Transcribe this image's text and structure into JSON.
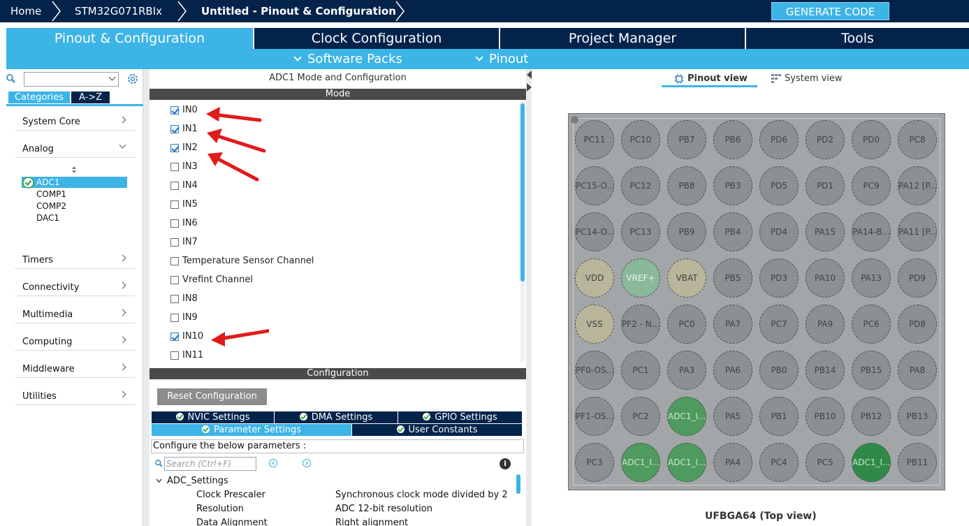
{
  "breadcrumb": {
    "home": "Home",
    "device": "STM32G071RBIx",
    "project": "Untitled - Pinout & Configuration"
  },
  "generate_label": "GENERATE CODE",
  "main_tabs": [
    "Pinout & Configuration",
    "Clock Configuration",
    "Project Manager",
    "Tools"
  ],
  "sub_menu": {
    "software_packs": "Software Packs",
    "pinout": "Pinout"
  },
  "left": {
    "tabs": [
      "Categories",
      "A->Z"
    ],
    "categories": [
      "System Core",
      "Analog",
      "Timers",
      "Connectivity",
      "Multimedia",
      "Computing",
      "Middleware",
      "Utilities"
    ],
    "analog_items": [
      "ADC1",
      "COMP1",
      "COMP2",
      "DAC1"
    ]
  },
  "mode": {
    "title": "ADC1 Mode and Configuration",
    "header": "Mode",
    "channels": [
      {
        "label": "IN0",
        "checked": true
      },
      {
        "label": "IN1",
        "checked": true
      },
      {
        "label": "IN2",
        "checked": true
      },
      {
        "label": "IN3",
        "checked": false
      },
      {
        "label": "IN4",
        "checked": false
      },
      {
        "label": "IN5",
        "checked": false
      },
      {
        "label": "IN6",
        "checked": false
      },
      {
        "label": "IN7",
        "checked": false
      },
      {
        "label": "Temperature Sensor Channel",
        "checked": false
      },
      {
        "label": "Vrefint Channel",
        "checked": false
      },
      {
        "label": "IN8",
        "checked": false
      },
      {
        "label": "IN9",
        "checked": false
      },
      {
        "label": "IN10",
        "checked": true
      },
      {
        "label": "IN11",
        "checked": false
      }
    ]
  },
  "config": {
    "header": "Configuration",
    "reset_label": "Reset Configuration",
    "tabs_row1": [
      "NVIC Settings",
      "DMA Settings",
      "GPIO Settings"
    ],
    "tabs_row2": [
      "Parameter Settings",
      "User Constants"
    ],
    "note": "Configure the below parameters :",
    "search_placeholder": "Search (Ctrl+F)",
    "info": "i",
    "group": "ADC_Settings",
    "params": [
      {
        "name": "Clock Prescaler",
        "value": "Synchronous clock mode divided by 2"
      },
      {
        "name": "Resolution",
        "value": "ADC 12-bit resolution"
      },
      {
        "name": "Data Alignment",
        "value": "Right alignment"
      }
    ]
  },
  "right": {
    "pinout_view": "Pinout view",
    "system_view": "System view",
    "package": "UFBGA64 (Top view)",
    "pins": [
      [
        "PC11",
        "PC10",
        "PB7",
        "PB6",
        "PD6",
        "PD2",
        "PD0",
        "PC8"
      ],
      [
        "PC15-O...",
        "PC12",
        "PB8",
        "PB3",
        "PD5",
        "PD1",
        "PC9",
        "PA12 [P..."
      ],
      [
        "PC14-O...",
        "PC13",
        "PB9",
        "PB4",
        "PD4",
        "PA15",
        "PA14-B...",
        "PA11 [P..."
      ],
      [
        "VDD",
        "VREF+",
        "VBAT",
        "PB5",
        "PD3",
        "PA10",
        "PA13",
        "PD9"
      ],
      [
        "VSS",
        "PF2 - N...",
        "PC0",
        "PA7",
        "PC7",
        "PA9",
        "PC6",
        "PD8"
      ],
      [
        "PF0-OS...",
        "PC1",
        "PA3",
        "PA6",
        "PB0",
        "PB14",
        "PB15",
        "PA8"
      ],
      [
        "PF1-OS...",
        "PC2",
        "ADC1_I...",
        "PA5",
        "PB1",
        "PB10",
        "PB12",
        "PB13"
      ],
      [
        "PC3",
        "ADC1_I...",
        "ADC1_I...",
        "PA4",
        "PC4",
        "PC5",
        "ADC1_I...",
        "PB11"
      ]
    ],
    "pin_kinds": [
      [
        "n",
        "n",
        "n",
        "n",
        "n",
        "n",
        "n",
        "n"
      ],
      [
        "n",
        "n",
        "n",
        "n",
        "n",
        "n",
        "n",
        "n"
      ],
      [
        "n",
        "n",
        "n",
        "n",
        "n",
        "n",
        "n",
        "n"
      ],
      [
        "power",
        "vref",
        "power",
        "n",
        "n",
        "n",
        "n",
        "n"
      ],
      [
        "power",
        "n",
        "n",
        "n",
        "n",
        "n",
        "n",
        "n"
      ],
      [
        "n",
        "n",
        "n",
        "n",
        "n",
        "n",
        "n",
        "n"
      ],
      [
        "n",
        "n",
        "adc",
        "n",
        "n",
        "n",
        "n",
        "n"
      ],
      [
        "n",
        "adc",
        "adc",
        "n",
        "n",
        "n",
        "adcsel",
        "n"
      ]
    ]
  },
  "colors": {
    "navy": "#03234b",
    "accent": "#3cb4e6",
    "adc_pin": "#4f9a5f",
    "arrow": "#e01b1b"
  }
}
